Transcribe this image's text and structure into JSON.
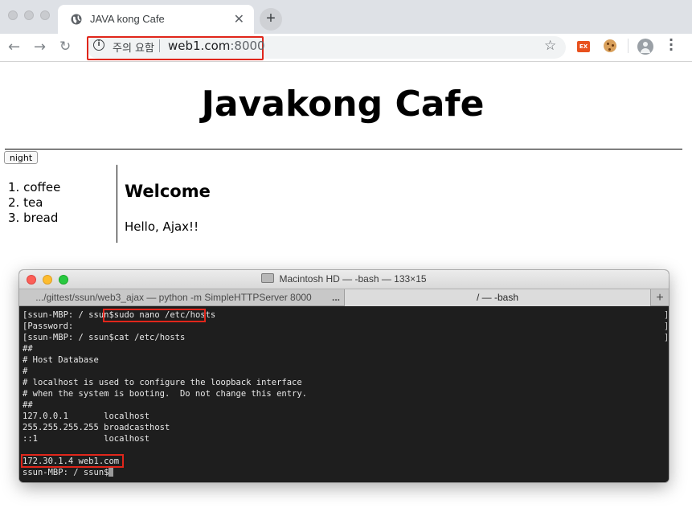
{
  "browser": {
    "tab": {
      "title": "JAVA kong Cafe",
      "favicon": "globe-icon",
      "close_glyph": "✕"
    },
    "new_tab_glyph": "+",
    "omnibox": {
      "security_text": "주의 요함",
      "url_host": "web1.com",
      "url_port": ":8000"
    },
    "extension_badge": "EX",
    "colors": {
      "highlight": "#e0261b"
    }
  },
  "page": {
    "title": "Javakong Cafe",
    "night_button": "night",
    "menu_items": [
      "1. coffee",
      "2. tea",
      "3. bread"
    ],
    "heading": "Welcome",
    "body_text": "Hello, Ajax!!"
  },
  "terminal": {
    "window_title": "Macintosh HD — -bash — 133×15",
    "tabs": [
      {
        "label": ".../gittest/ssun/web3_ajax — python -m SimpleHTTPServer 8000",
        "overflow": "..."
      },
      {
        "label": "/ — -bash"
      }
    ],
    "add_tab_glyph": "+",
    "prompt": "ssun-MBP: / ssun$",
    "lines": [
      {
        "prefix": "[ssun-MBP: / ssun$",
        "cmd": "sudo nano /etc/hosts",
        "bracket": "]"
      },
      {
        "prefix": "[Password:",
        "cmd": "",
        "bracket": "]"
      },
      {
        "prefix": "[ssun-MBP: / ssun$",
        "cmd": "cat /etc/hosts",
        "bracket": "]"
      },
      {
        "prefix": "##",
        "cmd": "",
        "bracket": ""
      },
      {
        "prefix": "# Host Database",
        "cmd": "",
        "bracket": ""
      },
      {
        "prefix": "#",
        "cmd": "",
        "bracket": ""
      },
      {
        "prefix": "# localhost is used to configure the loopback interface",
        "cmd": "",
        "bracket": ""
      },
      {
        "prefix": "# when the system is booting.  Do not change this entry.",
        "cmd": "",
        "bracket": ""
      },
      {
        "prefix": "##",
        "cmd": "",
        "bracket": ""
      },
      {
        "prefix": "127.0.0.1       localhost",
        "cmd": "",
        "bracket": ""
      },
      {
        "prefix": "255.255.255.255 broadcasthost",
        "cmd": "",
        "bracket": ""
      },
      {
        "prefix": "::1             localhost",
        "cmd": "",
        "bracket": ""
      },
      {
        "prefix": "",
        "cmd": "",
        "bracket": ""
      },
      {
        "prefix": "172.30.1.4 web1.com",
        "cmd": "",
        "bracket": ""
      }
    ]
  }
}
